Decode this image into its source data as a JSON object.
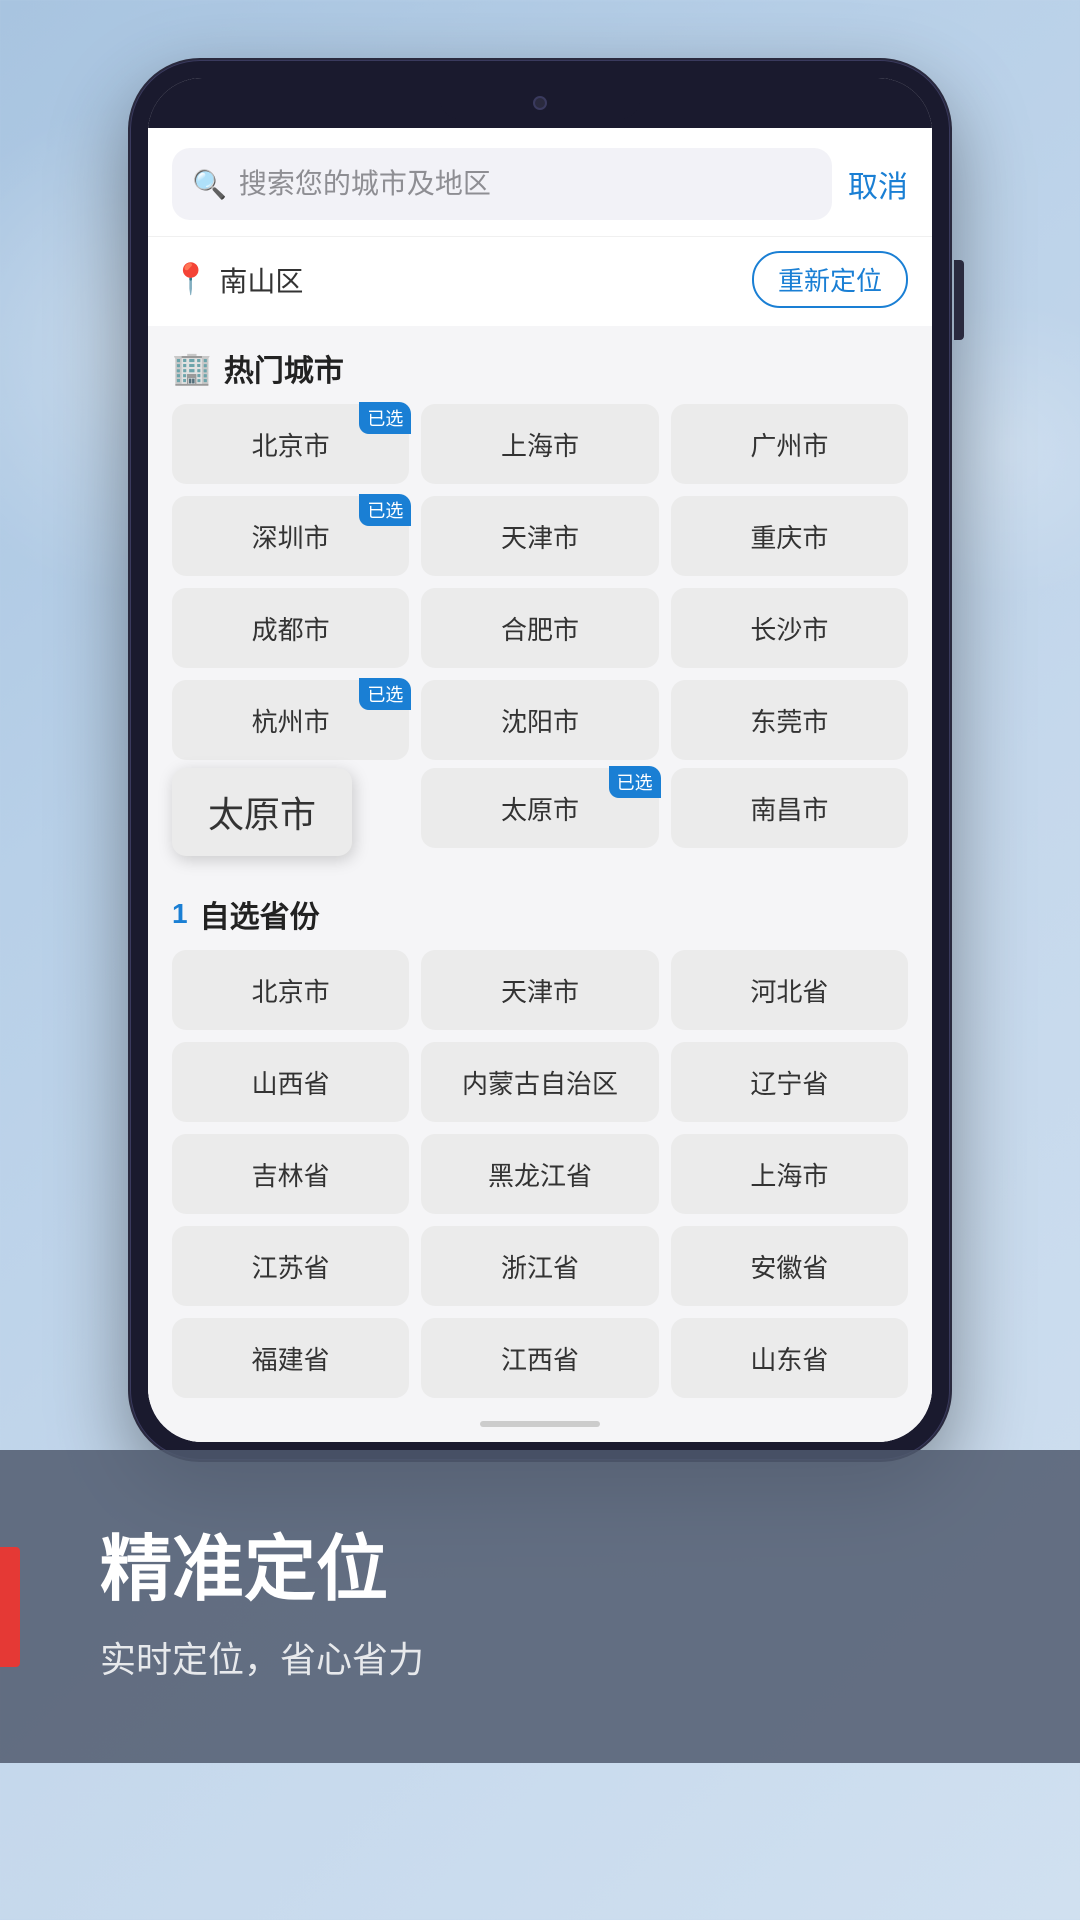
{
  "search": {
    "placeholder": "搜索您的城市及地区",
    "cancel_label": "取消"
  },
  "location": {
    "current": "南山区",
    "relocate_label": "重新定位"
  },
  "hot_cities": {
    "section_icon": "🏢",
    "section_title": "热门城市",
    "cities": [
      {
        "name": "北京市",
        "selected": true
      },
      {
        "name": "上海市",
        "selected": false
      },
      {
        "name": "广州市",
        "selected": false
      },
      {
        "name": "深圳市",
        "selected": true
      },
      {
        "name": "天津市",
        "selected": false
      },
      {
        "name": "重庆市",
        "selected": false
      },
      {
        "name": "成都市",
        "selected": false
      },
      {
        "name": "合肥市",
        "selected": false
      },
      {
        "name": "长沙市",
        "selected": false
      },
      {
        "name": "杭州市",
        "selected": true
      },
      {
        "name": "沈阳市",
        "selected": false
      },
      {
        "name": "东莞市",
        "selected": false
      },
      {
        "name": "太原市",
        "selected": true
      },
      {
        "name": "太原市",
        "selected": true
      },
      {
        "name": "南昌市",
        "selected": false
      }
    ],
    "tooltip": "太原市"
  },
  "provinces": {
    "section_icon": "🔢",
    "section_title": "自选省份",
    "items": [
      {
        "name": "北京市"
      },
      {
        "name": "天津市"
      },
      {
        "name": "河北省"
      },
      {
        "name": "山西省"
      },
      {
        "name": "内蒙古自治区"
      },
      {
        "name": "辽宁省"
      },
      {
        "name": "吉林省"
      },
      {
        "name": "黑龙江省"
      },
      {
        "name": "上海市"
      },
      {
        "name": "江苏省"
      },
      {
        "name": "浙江省"
      },
      {
        "name": "安徽省"
      },
      {
        "name": "福建省"
      },
      {
        "name": "江西省"
      },
      {
        "name": "山东省"
      }
    ]
  },
  "promo": {
    "title": "精准定位",
    "subtitle": "实时定位，省心省力"
  }
}
